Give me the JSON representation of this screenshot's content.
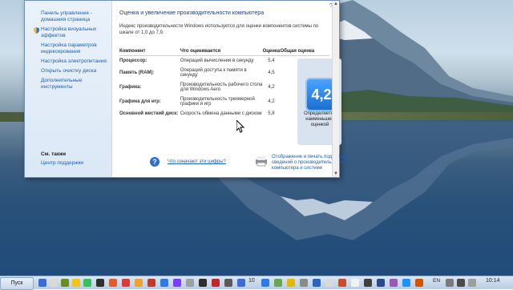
{
  "sidebar": {
    "links": [
      "Панель управления - домашняя страница",
      "Настройка визуальных эффектов",
      "Настройка параметров индексирования",
      "Настройка электропитания",
      "Открыть очистку диска",
      "Дополнительные инструменты"
    ],
    "see_also": "См. также",
    "help_center": "Центр поддержки"
  },
  "main": {
    "heading": "Оценка и увеличение производительности компьютера",
    "description": "Индекс производительности Windows используется для оценки компонентов системы по шкале от 1,0 до 7,9.",
    "columns": [
      "Компонент",
      "Что оценивается",
      "Оценка",
      "Общая оценка"
    ],
    "rows": [
      {
        "component": "Процессор:",
        "what": "Операций вычисления в секунду",
        "score": "5,4"
      },
      {
        "component": "Память (RAM):",
        "what": "Операций доступа к памяти в секунду",
        "score": "4,5"
      },
      {
        "component": "Графика:",
        "what": "Производительность рабочего стола для Windows Aero",
        "score": "4,2"
      },
      {
        "component": "Графика для игр:",
        "what": "Производительность трехмерной графики и игр",
        "score": "4,2"
      },
      {
        "component": "Основной жесткий диск:",
        "what": "Скорость обмена данными с диском",
        "score": "5,8"
      }
    ],
    "base_score": "4,2",
    "base_score_text": "Определяется наименьшей оценкой",
    "help_link": "Что означают эти цифры?",
    "print_link": "Отображение и печать подробных сведений о производительности компьютера и системе"
  },
  "taskbar": {
    "start_label": "Пуск",
    "center_number": "10",
    "language": "EN",
    "time": "10:14"
  }
}
